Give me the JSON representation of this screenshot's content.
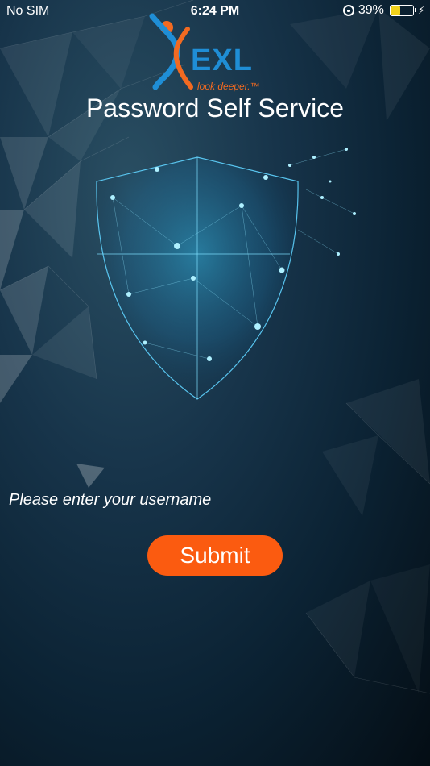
{
  "status_bar": {
    "carrier": "No SIM",
    "time": "6:24 PM",
    "battery_percent": "39%",
    "battery_level": 0.39,
    "icons": [
      "orientation-lock-icon",
      "battery-icon",
      "charging-icon"
    ]
  },
  "logo": {
    "name": "EXL",
    "tagline": "look deeper.™"
  },
  "title": "Password Self Service",
  "form": {
    "username_placeholder": "Please enter your username",
    "username_value": "",
    "submit_label": "Submit"
  },
  "colors": {
    "accent": "#fb5b10",
    "logo_blue": "#1f8ed6",
    "logo_orange": "#f26a21",
    "background_dark": "#0b2233",
    "battery": "#f2d21b"
  }
}
